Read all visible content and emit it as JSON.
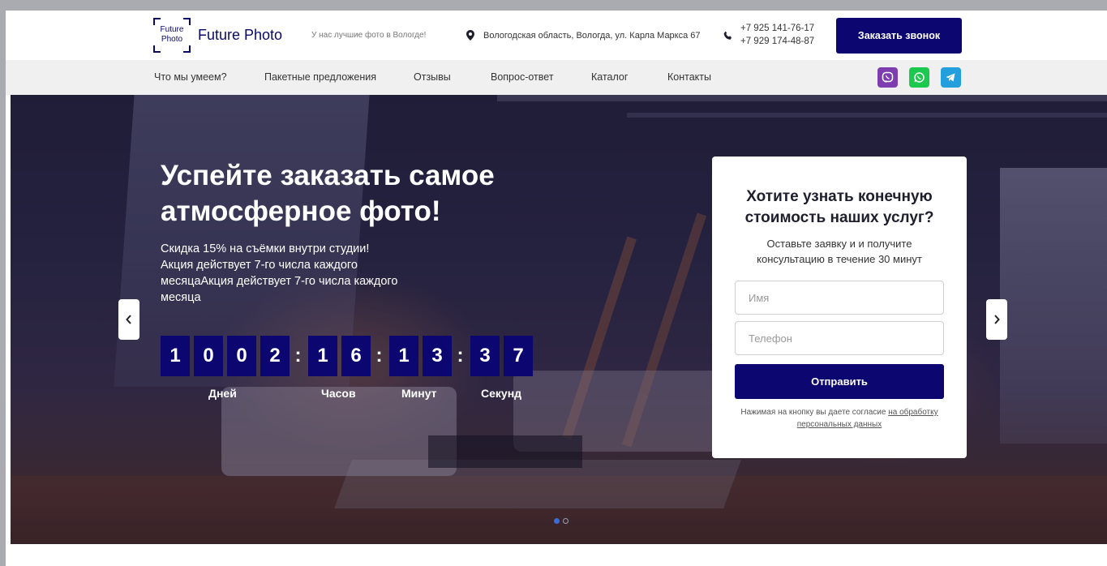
{
  "header": {
    "logo_line1": "Future",
    "logo_line2": "Photo",
    "brand": "Future Photo",
    "slogan": "У нас лучшие фото в Вологде!",
    "address": "Вологодская область, Вологда, ул. Карла Маркса 67",
    "phone1": "+7 925 141-76-17",
    "phone2": "+7 929 174-48-87",
    "cta_label": "Заказать звонок"
  },
  "nav": {
    "items": [
      {
        "label": "Что мы умеем?"
      },
      {
        "label": "Пакетные предложения"
      },
      {
        "label": "Отзывы"
      },
      {
        "label": "Вопрос-ответ"
      },
      {
        "label": "Каталог"
      },
      {
        "label": "Контакты"
      }
    ],
    "social": [
      "viber-icon",
      "whatsapp-icon",
      "telegram-icon"
    ]
  },
  "hero": {
    "title": "Успейте заказать самое атмосферное фото!",
    "lead": "Скидка 15% на съёмки внутри студии! Акция действует 7-го числа каждого месяцаАкция действует 7-го числа каждого месяца",
    "countdown": {
      "digits": [
        "1",
        "0",
        "0",
        "2",
        "1",
        "6",
        "1",
        "3",
        "3",
        "7"
      ],
      "separator": ":",
      "labels": {
        "days": "Дней",
        "hours": "Часов",
        "minutes": "Минут",
        "seconds": "Секунд"
      }
    },
    "slides_total": 2,
    "active_slide": 1
  },
  "form": {
    "title": "Хотите узнать конечную стоимость наших услуг?",
    "subtitle": "Оставьте заявку и и получите консультацию в течение 30 минут",
    "name_placeholder": "Имя",
    "phone_placeholder": "Телефон",
    "submit_label": "Отправить",
    "note_prefix": "Нажимая на кнопку вы даете согласие ",
    "note_link": "на обработку персональных данных"
  },
  "colors": {
    "accent": "#0b0670",
    "viber": "#7d3daf",
    "whatsapp": "#1ac94e",
    "telegram": "#229fdc"
  }
}
